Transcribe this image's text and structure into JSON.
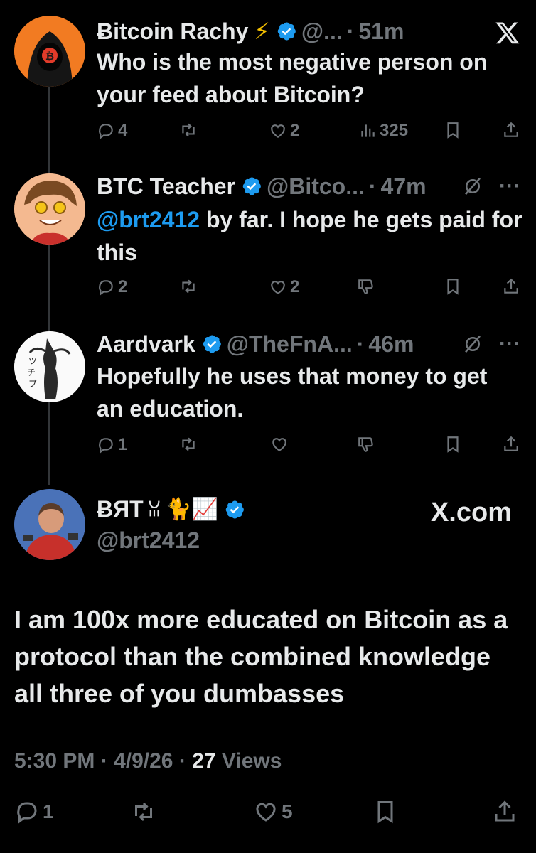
{
  "posts": [
    {
      "name": "Ƀitcoin Rachy",
      "emoji": "⚡",
      "handle": "@...",
      "time": "51m",
      "text": "Who is the most negative person on your feed about Bitcoin?",
      "replies": "4",
      "reposts": "",
      "likes": "2",
      "views": "325"
    },
    {
      "name": "BTC Teacher",
      "handle": "@Bitco...",
      "time": "47m",
      "mention": "@brt2412",
      "text_after_mention": " by far. I hope he gets paid for this",
      "replies": "2",
      "likes": "2"
    },
    {
      "name": "Aardvark",
      "handle": "@TheFnA...",
      "time": "46m",
      "text": "Hopefully he uses that money to get an education.",
      "replies": "1",
      "likes": ""
    }
  ],
  "main": {
    "name": "ɃЯT",
    "name_suffix": "ꈍ",
    "emojis": "🐈📈",
    "handle": "@brt2412",
    "watermark": "X.com",
    "text": "I am 100x more educated on Bitcoin as a protocol than the combined knowledge all three of you dumbasses",
    "time": "5:30 PM",
    "date": "4/9/26",
    "views_count": "27",
    "views_label": "Views",
    "replies": "1",
    "likes": "5"
  },
  "colors": {
    "background": "#000000",
    "text": "#e7e9ea",
    "secondary": "#71767b",
    "verified": "#1d9bf0",
    "mention": "#1d9bf0"
  },
  "sep": "·"
}
